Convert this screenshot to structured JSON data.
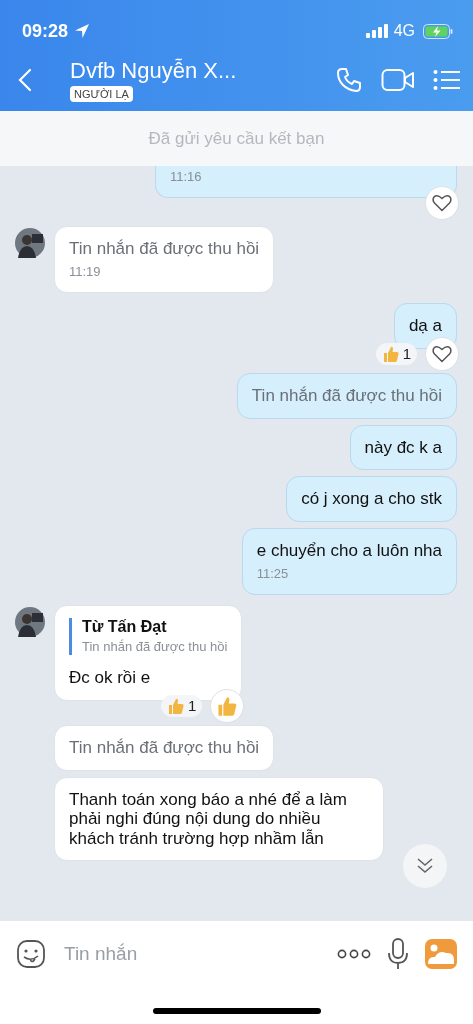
{
  "status_bar": {
    "time": "09:28",
    "network": "4G"
  },
  "header": {
    "title": "Dvfb Nguyễn X...",
    "badge": "NGƯỜI LẠ"
  },
  "friend_request_bar": {
    "text": "Đã gửi yêu cầu kết bạn"
  },
  "messages": [
    {
      "outgoing": true,
      "kind": "text",
      "time": "11:16",
      "react_button": {
        "kind": "heart"
      },
      "cut_top": true
    },
    {
      "outgoing": false,
      "kind": "recalled",
      "text": "Tin nhắn đã được thu hồi",
      "time": "11:19",
      "avatar": true
    },
    {
      "outgoing": true,
      "kind": "text",
      "text": "dạ a",
      "reaction": {
        "count": "1"
      },
      "react_button": {
        "kind": "heart"
      }
    },
    {
      "outgoing": true,
      "kind": "recalled",
      "text": "Tin nhắn đã được thu hồi"
    },
    {
      "outgoing": true,
      "kind": "text",
      "text": "này đc k a"
    },
    {
      "outgoing": true,
      "kind": "text",
      "text": "có j xong a cho stk"
    },
    {
      "outgoing": true,
      "kind": "text",
      "text": "e chuyển cho a luôn nha",
      "time": "11:25"
    },
    {
      "outgoing": false,
      "kind": "text",
      "quote": {
        "author": "Từ Tấn Đạt",
        "text": "Tin nhắn đã được thu hồi"
      },
      "text": "Đc ok rồi e",
      "avatar": true,
      "reaction": {
        "count": "1"
      },
      "react_button": {
        "kind": "like"
      }
    },
    {
      "outgoing": false,
      "kind": "recalled",
      "text": "Tin nhắn đã được thu hồi",
      "avatar": false
    },
    {
      "outgoing": false,
      "kind": "text",
      "text": "Thanh toán xong báo a nhé để a làm phải nghi đúng nội dung do nhiều khách tránh trường hợp nhầm lẫn",
      "avatar": false
    }
  ],
  "composer": {
    "placeholder": "Tin nhắn"
  }
}
